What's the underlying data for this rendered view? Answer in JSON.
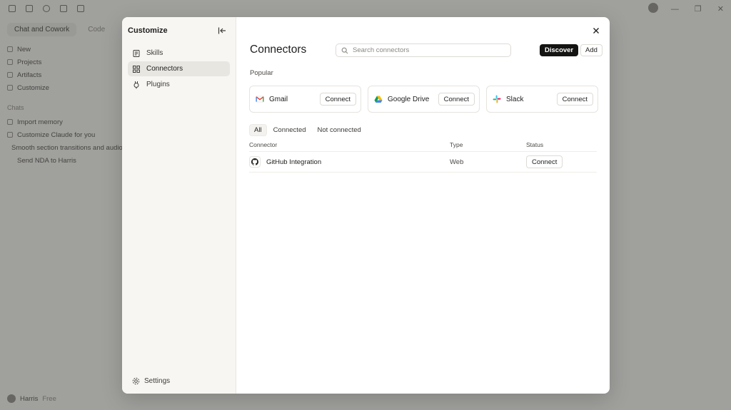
{
  "background": {
    "tabs": [
      "Chat and Cowork",
      "Code"
    ],
    "nav": [
      "New",
      "Projects",
      "Artifacts",
      "Customize"
    ],
    "chats_label": "Chats",
    "chats": [
      "Import memory",
      "Customize Claude for you",
      "Smooth section transitions and audio",
      "Send NDA to Harris"
    ],
    "user_name": "Harris",
    "user_plan": "Free"
  },
  "sidebar": {
    "title": "Customize",
    "items": [
      {
        "label": "Skills",
        "icon": "skills-icon"
      },
      {
        "label": "Connectors",
        "icon": "connectors-icon",
        "active": true
      },
      {
        "label": "Plugins",
        "icon": "plugins-icon"
      }
    ],
    "settings_label": "Settings"
  },
  "main": {
    "title": "Connectors",
    "search_placeholder": "Search connectors",
    "discover_label": "Discover",
    "add_label": "Add",
    "popular_label": "Popular",
    "popular": [
      {
        "name": "Gmail",
        "icon": "gmail-icon",
        "action": "Connect"
      },
      {
        "name": "Google Drive",
        "icon": "google-drive-icon",
        "action": "Connect"
      },
      {
        "name": "Slack",
        "icon": "slack-icon",
        "action": "Connect"
      }
    ],
    "filters": [
      "All",
      "Connected",
      "Not connected"
    ],
    "active_filter": "All",
    "table": {
      "headers": [
        "Connector",
        "Type",
        "Status"
      ],
      "rows": [
        {
          "name": "GitHub Integration",
          "icon": "github-icon",
          "type": "Web",
          "action": "Connect"
        }
      ]
    }
  },
  "colors": {
    "accent_dark": "#141413",
    "sidebar_bg": "#f7f6f3",
    "active_nav_bg": "#e8e6e1"
  }
}
